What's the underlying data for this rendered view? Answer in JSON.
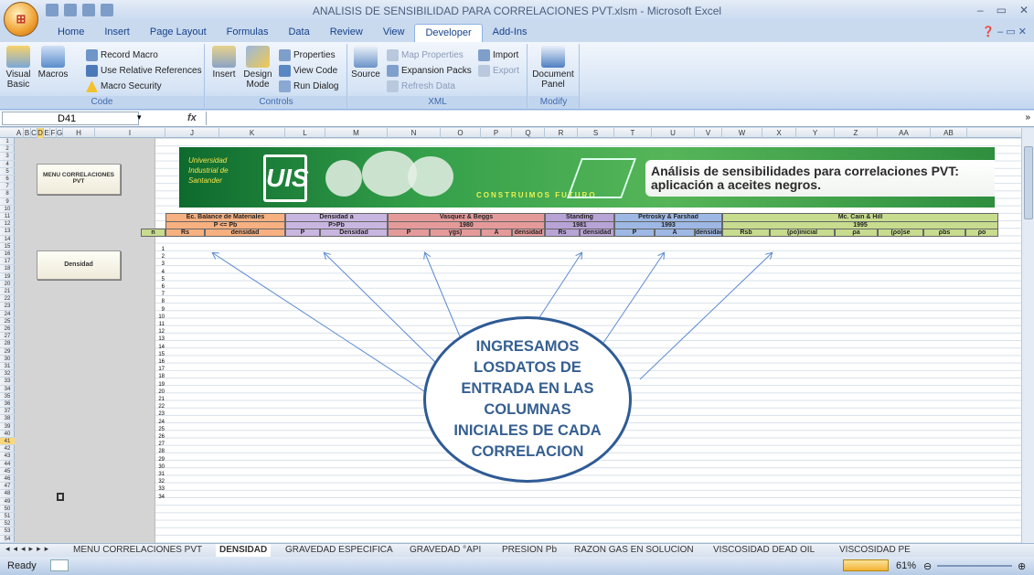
{
  "window": {
    "title": "ANALISIS DE SENSIBILIDAD PARA CORRELACIONES PVT.xlsm - Microsoft Excel"
  },
  "tabs": [
    "Home",
    "Insert",
    "Page Layout",
    "Formulas",
    "Data",
    "Review",
    "View",
    "Developer",
    "Add-Ins"
  ],
  "ribbon": {
    "code": {
      "label": "Code",
      "visual_basic": "Visual Basic",
      "macros": "Macros",
      "record_macro": "Record Macro",
      "use_relative": "Use Relative References",
      "macro_security": "Macro Security"
    },
    "controls": {
      "label": "Controls",
      "insert": "Insert",
      "design_mode": "Design Mode",
      "properties": "Properties",
      "view_code": "View Code",
      "run_dialog": "Run Dialog"
    },
    "xml": {
      "label": "XML",
      "source": "Source",
      "map_properties": "Map Properties",
      "expansion_packs": "Expansion Packs",
      "refresh_data": "Refresh Data",
      "import": "Import",
      "export": "Export"
    },
    "modify": {
      "label": "Modify",
      "document_panel": "Document Panel"
    }
  },
  "formula_bar": {
    "name_box": "D41",
    "fx": "fx",
    "formula": ""
  },
  "columns": [
    "A",
    "B",
    "C",
    "D",
    "E",
    "F",
    "G",
    "H",
    "I",
    "J",
    "K",
    "L",
    "M",
    "N",
    "O",
    "P",
    "Q",
    "R",
    "S",
    "T",
    "U",
    "V",
    "W",
    "X",
    "Y",
    "Z",
    "AA",
    "AB"
  ],
  "sheet": {
    "menu_button": "MENU CORRELACIONES PVT",
    "density_button": "Densidad",
    "banner": {
      "institution": "Universidad Industrial de Santander",
      "logo": "UIS",
      "motto": "CONSTRUIMOS FUTURO",
      "title": "Análisis de sensibilidades para correlaciones PVT: aplicación a aceites negros."
    },
    "groups": [
      {
        "title": "Ec. Balance de Materiales",
        "subtitle": "P <= Pb",
        "color": "#f7b080",
        "cols": [
          "Rs",
          "densidad"
        ]
      },
      {
        "title": "Densidad a",
        "subtitle": "P>Pb",
        "color": "#c9b6e0",
        "cols": [
          "P",
          "Densidad"
        ]
      },
      {
        "title": "Vasquez & Beggs",
        "subtitle": "1980",
        "color": "#e59a9a",
        "cols": [
          "P",
          "γgs)",
          "A",
          "densidad"
        ]
      },
      {
        "title": "Standing",
        "subtitle": "1981",
        "color": "#b8a3d6",
        "cols": [
          "Rs",
          "densidad"
        ]
      },
      {
        "title": "Petrosky & Farshad",
        "subtitle": "1993",
        "color": "#9db8e4",
        "cols": [
          "P",
          "A",
          "densidad"
        ]
      },
      {
        "title": "Mc. Cain & Hill",
        "subtitle": "1995",
        "color": "#c7dc8e",
        "cols": [
          "Rsb",
          "(ρo)inicial",
          "ρa",
          "(ρo)se",
          "ρbs",
          "ρo"
        ]
      }
    ],
    "n_header": "n",
    "callout": "INGRESAMOS LOSDATOS DE ENTRADA EN LAS COLUMNAS INICIALES DE CADA CORRELACION"
  },
  "sheet_tabs": [
    "MENU CORRELACIONES PVT",
    "DENSIDAD",
    "GRAVEDAD ESPECIFICA",
    "GRAVEDAD °API",
    "PRESION Pb",
    "RAZON GAS EN SOLUCION",
    "VISCOSIDAD DEAD OIL",
    "VISCOSIDAD PE"
  ],
  "active_sheet": "DENSIDAD",
  "status": {
    "ready": "Ready",
    "zoom": "61%"
  }
}
